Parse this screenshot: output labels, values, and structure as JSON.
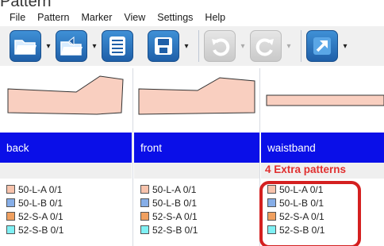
{
  "window_title": "Pattern",
  "menu": [
    "File",
    "Pattern",
    "Marker",
    "View",
    "Settings",
    "Help"
  ],
  "toolbar": {
    "buttons": [
      {
        "name": "open",
        "icon": "open-folder-icon",
        "has_dropdown": true,
        "enabled": true
      },
      {
        "name": "open-recent",
        "icon": "open-recent-folder-icon",
        "has_dropdown": true,
        "enabled": true
      },
      {
        "name": "list",
        "icon": "list-icon",
        "has_dropdown": false,
        "enabled": true
      },
      {
        "name": "save",
        "icon": "save-icon",
        "has_dropdown": true,
        "enabled": true
      },
      {
        "name": "undo",
        "icon": "undo-icon",
        "has_dropdown": true,
        "enabled": false
      },
      {
        "name": "redo",
        "icon": "redo-icon",
        "has_dropdown": true,
        "enabled": false
      },
      {
        "name": "export",
        "icon": "export-arrow-icon",
        "has_dropdown": true,
        "enabled": true
      }
    ]
  },
  "columns": [
    {
      "name": "back",
      "pieces": [
        {
          "label": "50-L-A 0/1",
          "color": "#f8c3ac"
        },
        {
          "label": "50-L-B 0/1",
          "color": "#86aee8"
        },
        {
          "label": "52-S-A 0/1",
          "color": "#f0a060"
        },
        {
          "label": "52-S-B 0/1",
          "color": "#7ff0f4"
        }
      ]
    },
    {
      "name": "front",
      "pieces": [
        {
          "label": "50-L-A 0/1",
          "color": "#f8c3ac"
        },
        {
          "label": "50-L-B 0/1",
          "color": "#86aee8"
        },
        {
          "label": "52-S-A 0/1",
          "color": "#f0a060"
        },
        {
          "label": "52-S-B 0/1",
          "color": "#7ff0f4"
        }
      ]
    },
    {
      "name": "waistband",
      "pieces": [
        {
          "label": "50-L-A 0/1",
          "color": "#f8c3ac"
        },
        {
          "label": "50-L-B 0/1",
          "color": "#86aee8"
        },
        {
          "label": "52-S-A 0/1",
          "color": "#f0a060"
        },
        {
          "label": "52-S-B 0/1",
          "color": "#7ff0f4"
        }
      ]
    }
  ],
  "annotation": "4 Extra patterns",
  "colors": {
    "piece_fill": "#f9cfc0",
    "name_bar": "#0a0fe8",
    "annotation": "#e03030",
    "highlight": "#d42020"
  }
}
